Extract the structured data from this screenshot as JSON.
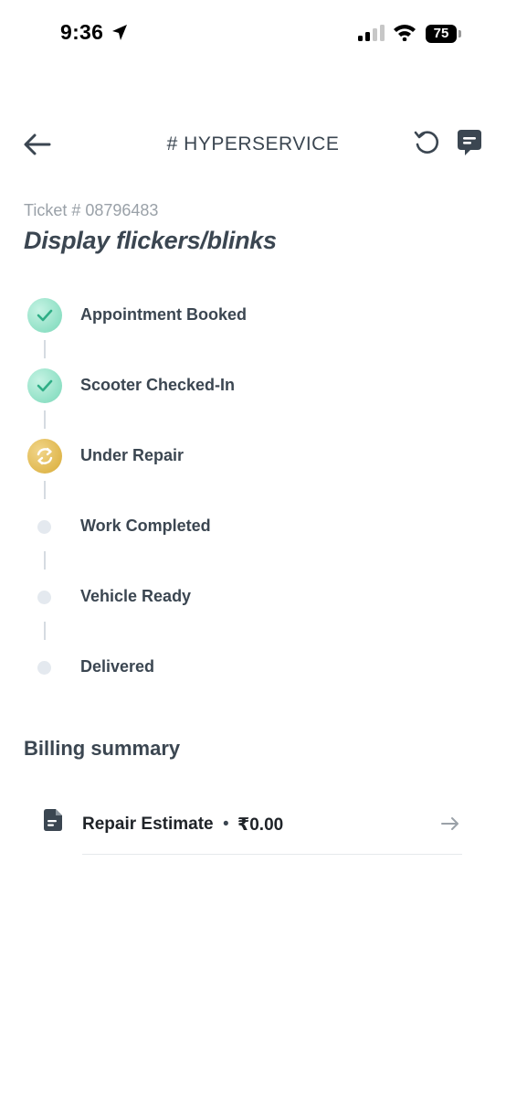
{
  "status": {
    "time": "9:36",
    "battery": "75"
  },
  "header": {
    "title": "# HYPERSERVICE"
  },
  "ticket": {
    "number": "Ticket # 08796483",
    "title": "Display flickers/blinks"
  },
  "timeline": {
    "steps": [
      {
        "label": "Appointment Booked",
        "state": "done"
      },
      {
        "label": "Scooter Checked-In",
        "state": "done"
      },
      {
        "label": "Under Repair",
        "state": "in-progress"
      },
      {
        "label": "Work Completed",
        "state": "pending"
      },
      {
        "label": "Vehicle Ready",
        "state": "pending"
      },
      {
        "label": "Delivered",
        "state": "pending"
      }
    ]
  },
  "billing": {
    "title": "Billing summary",
    "items": [
      {
        "label": "Repair Estimate",
        "separator": "•",
        "amount": "₹0.00"
      }
    ]
  },
  "icons": {
    "back": "arrow-left-icon",
    "history": "history-icon",
    "chat": "chat-icon",
    "done": "check-icon",
    "progress": "refresh-icon",
    "document": "document-icon",
    "go": "arrow-right-icon"
  },
  "colors": {
    "text": "#3b4651",
    "muted": "#9aa1a8",
    "done": "#8fe0c5",
    "progress": "#e0b84f",
    "pending": "#e4e9ef"
  }
}
